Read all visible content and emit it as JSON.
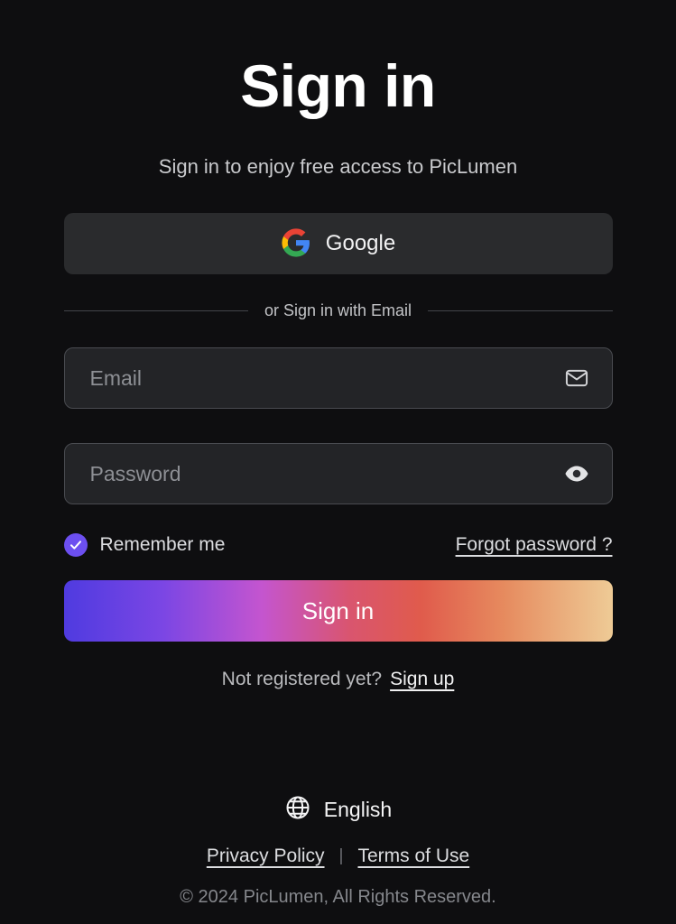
{
  "header": {
    "title": "Sign in",
    "subtitle": "Sign in to enjoy free access to PicLumen"
  },
  "oauth": {
    "google_label": "Google",
    "google_icon": "google-g-icon"
  },
  "divider": {
    "text": "or Sign in with Email"
  },
  "form": {
    "email": {
      "placeholder": "Email",
      "value": "",
      "icon": "envelope-icon"
    },
    "password": {
      "placeholder": "Password",
      "value": "",
      "icon": "eye-icon"
    },
    "remember_me": {
      "label": "Remember me",
      "checked": true,
      "icon": "check-icon"
    },
    "forgot_password": "Forgot password ?",
    "submit_label": "Sign in"
  },
  "register": {
    "prompt": "Not registered yet?",
    "link": "Sign up"
  },
  "footer": {
    "language": "English",
    "language_icon": "globe-icon",
    "privacy_policy": "Privacy Policy",
    "separator": "|",
    "terms_of_use": "Terms of Use",
    "copyright": "© 2024 PicLumen, All Rights Reserved."
  },
  "colors": {
    "background": "#0e0e10",
    "surface": "#2a2b2d",
    "input_surface": "#232427",
    "accent_purple": "#6c4ff0",
    "gradient_start": "#4f3be0",
    "gradient_mid_magenta": "#c455cf",
    "gradient_mid_red": "#e05b4c",
    "gradient_end": "#eecb96"
  }
}
